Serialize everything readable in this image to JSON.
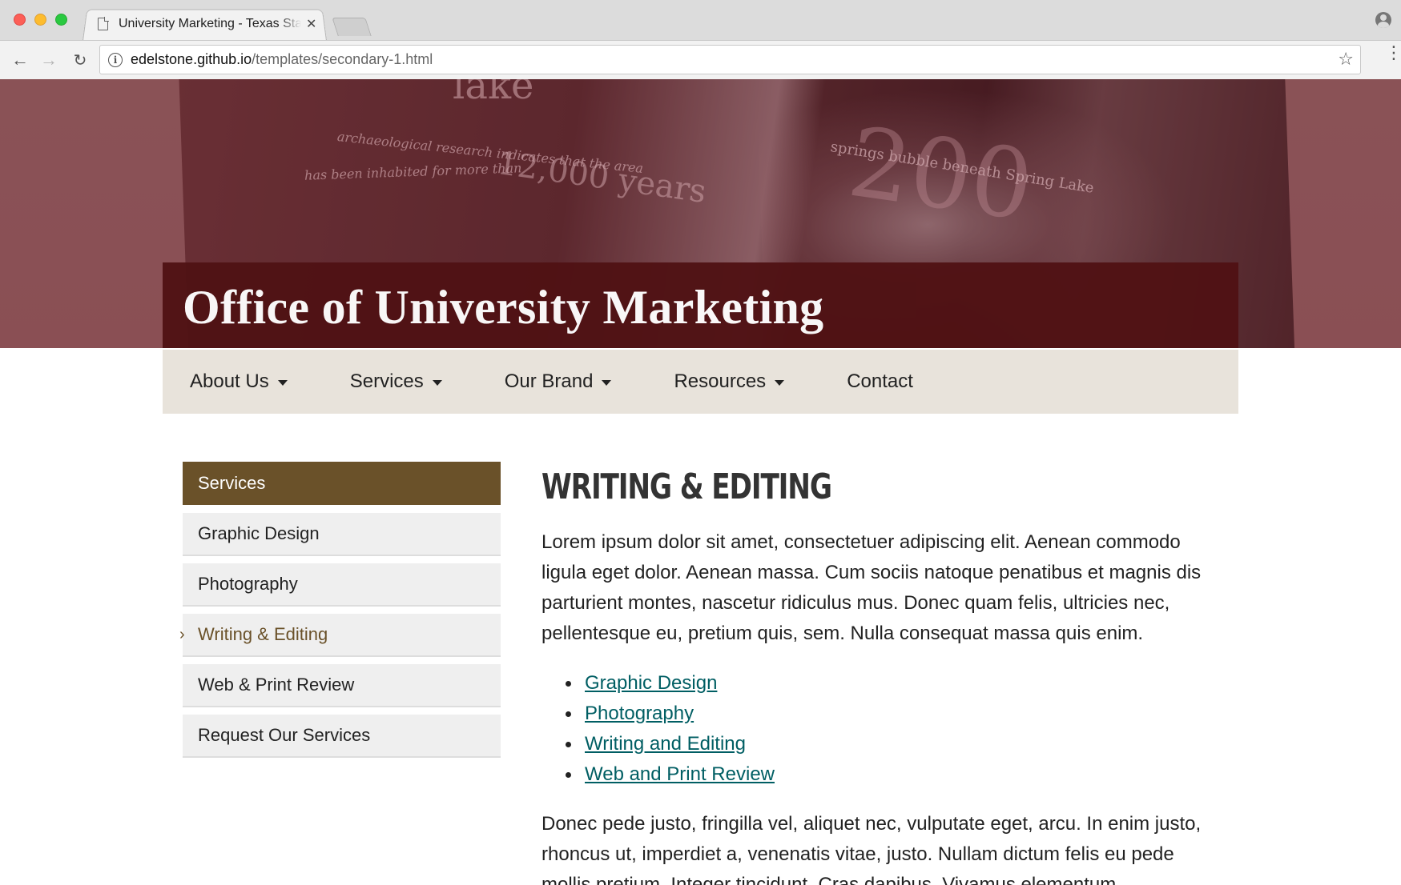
{
  "browser": {
    "tab_title": "University Marketing - Texas State",
    "url_host": "edelstone.github.io",
    "url_path": "/templates/secondary-1.html",
    "icons": [
      "page-icon",
      "close-icon",
      "back-icon",
      "forward-icon",
      "reload-icon",
      "info-icon",
      "star-icon",
      "menu-icon",
      "profile-icon"
    ]
  },
  "hero": {
    "site_title": "Office of University Marketing",
    "image_text": {
      "top": "lake",
      "research": "archaeological research indicates that the area",
      "inhabited": "has been inhabited for more than",
      "years": "12,000 years",
      "springs": "springs bubble beneath Spring Lake",
      "count": "200"
    },
    "colors": {
      "title_bar": "#501214"
    }
  },
  "nav": {
    "items": [
      {
        "label": "About Us",
        "dropdown": true
      },
      {
        "label": "Services",
        "dropdown": true
      },
      {
        "label": "Our Brand",
        "dropdown": true
      },
      {
        "label": "Resources",
        "dropdown": true
      },
      {
        "label": "Contact",
        "dropdown": false
      }
    ]
  },
  "sidebar": {
    "heading": "Services",
    "items": [
      {
        "label": "Graphic Design",
        "active": false
      },
      {
        "label": "Photography",
        "active": false
      },
      {
        "label": "Writing & Editing",
        "active": true
      },
      {
        "label": "Web & Print Review",
        "active": false
      },
      {
        "label": "Request Our Services",
        "active": false
      }
    ],
    "colors": {
      "heading_bg": "#6a5129",
      "active_text": "#6a5129"
    }
  },
  "content": {
    "heading": "WRITING & EDITING",
    "paragraph1": "Lorem ipsum dolor sit amet, consectetuer adipiscing elit. Aenean commodo ligula eget dolor. Aenean massa. Cum sociis natoque penatibus et magnis dis parturient montes, nascetur ridiculus mus. Donec quam felis, ultricies nec, pellentesque eu, pretium quis, sem. Nulla consequat massa quis enim.",
    "links": [
      "Graphic Design",
      "Photography",
      "Writing and Editing",
      "Web and Print Review"
    ],
    "paragraph2": "Donec pede justo, fringilla vel, aliquet nec, vulputate eget, arcu. In enim justo, rhoncus ut, imperdiet a, venenatis vitae, justo. Nullam dictum felis eu pede mollis pretium. Integer tincidunt. Cras dapibus. Vivamus elementum",
    "colors": {
      "link": "#005e63"
    }
  }
}
